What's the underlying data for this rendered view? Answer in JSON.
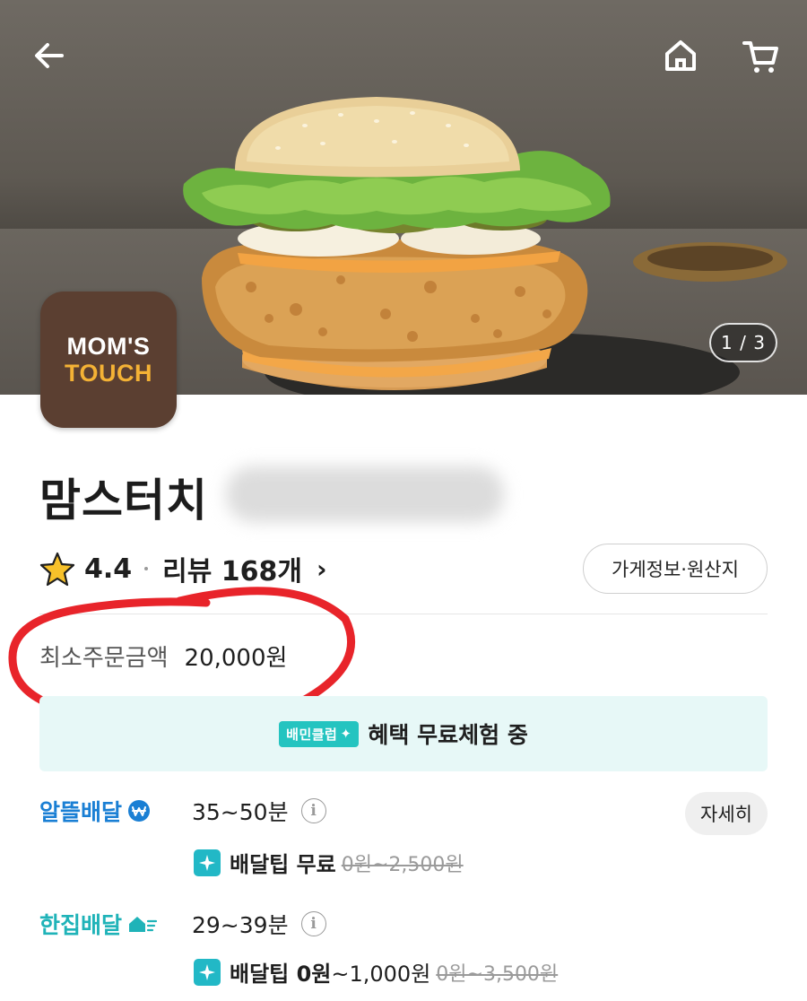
{
  "hero": {
    "page_indicator": "1 / 3",
    "back_icon": "arrow-left-icon",
    "home_icon": "home-icon",
    "cart_icon": "cart-icon"
  },
  "logo": {
    "line1": "MOM'S",
    "line2": "TOUCH"
  },
  "store": {
    "name": "맘스터치",
    "rating": "4.4",
    "review_label": "리뷰 168개",
    "info_button": "가게정보·원산지"
  },
  "min_order": {
    "label": "최소주문금액",
    "value": "20,000원"
  },
  "club": {
    "badge": "배민클럽",
    "text": "혜택 무료체험 중"
  },
  "delivery": [
    {
      "name": "알뜰배달",
      "time": "35~50분",
      "tip_label": "배달팁 무료",
      "tip_price": "",
      "tip_original": "0원~2,500원",
      "color": "#1a7fd4"
    },
    {
      "name": "한집배달",
      "time": "29~39분",
      "tip_label": "배달팁 0원",
      "tip_price": "~1,000원",
      "tip_original": "0원~3,500원",
      "color": "#1fb3b8"
    }
  ],
  "detail_button": "자세히",
  "colors": {
    "accent": "#24c4c0",
    "annotation": "#e8242a",
    "brand_logo": "#5b3f31"
  }
}
